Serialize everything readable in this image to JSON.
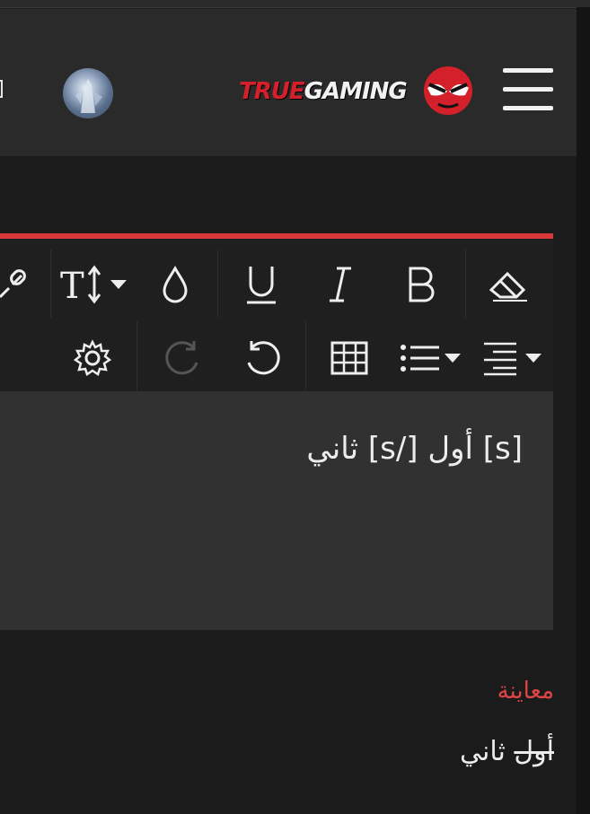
{
  "header": {
    "logo_part1": "TRUE",
    "logo_part2": "GAMING",
    "brand_color": "#d3202a",
    "avatar_icon": "user-avatar",
    "menu_icon": "hamburger-menu-icon"
  },
  "editor": {
    "accent_color": "#d9383a",
    "toolbar": {
      "row1": [
        "eraser-icon",
        "bold-icon",
        "italic-icon",
        "underline-icon",
        "color-drop-icon",
        "font-size-icon",
        "link-icon"
      ],
      "row2": [
        "align-icon",
        "list-icon",
        "table-icon",
        "undo-icon",
        "redo-icon",
        "settings-icon"
      ]
    },
    "content": "[s] أول [/s] ثاني"
  },
  "preview": {
    "label": "معاينة",
    "strike_text": "أول",
    "rest_text": " ثاني"
  }
}
